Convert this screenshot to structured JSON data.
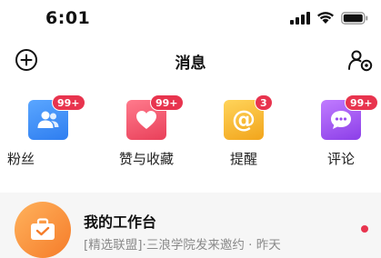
{
  "status_bar": {
    "time": "6:01",
    "icons": [
      "cellular-signal-icon",
      "wifi-icon",
      "battery-icon"
    ]
  },
  "header": {
    "title": "消息",
    "left_icon": "add-circle-icon",
    "right_icon": "contacts-settings-icon"
  },
  "categories": [
    {
      "label": "粉丝",
      "badge": "99+",
      "icon": "fans-icon",
      "color": "#3b8ef0"
    },
    {
      "label": "赞与收藏",
      "badge": "99+",
      "icon": "heart-icon",
      "color": "#ef4f65"
    },
    {
      "label": "提醒",
      "badge": "3",
      "icon": "mention-at-icon",
      "color": "#f5b42a"
    },
    {
      "label": "评论",
      "badge": "99+",
      "icon": "comment-bubble-icon",
      "color": "#9b4ef0"
    }
  ],
  "list": [
    {
      "title": "我的工作台",
      "subtitle": "[精选联盟]·三浪学院发来邀约 · 昨天",
      "icon": "briefcase-icon",
      "unread": true
    }
  ],
  "colors": {
    "badge": "#e8344e",
    "list_background": "#f6f6f6",
    "avatar_orange": "#f57c2a"
  }
}
